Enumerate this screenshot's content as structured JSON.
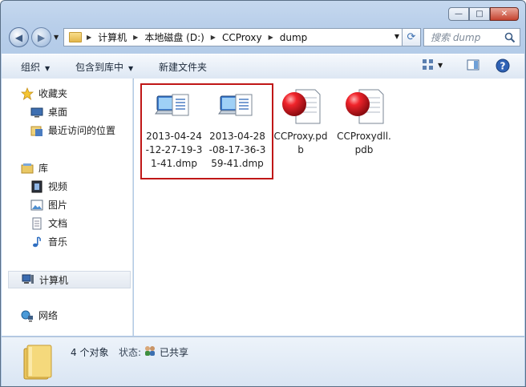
{
  "window": {
    "caption_buttons": {
      "minimize": "—",
      "maximize": "□",
      "close": "✕"
    }
  },
  "nav": {
    "back_icon": "back-arrow-icon",
    "forward_icon": "forward-arrow-icon",
    "breadcrumb": [
      "计算机",
      "本地磁盘 (D:)",
      "CCProxy",
      "dump"
    ],
    "search_placeholder": "搜索 dump"
  },
  "toolbar": {
    "organize": "组织",
    "include_in_library": "包含到库中",
    "new_folder": "新建文件夹"
  },
  "sidebar": {
    "favorites": {
      "label": "收藏夹",
      "items": [
        "桌面",
        "最近访问的位置"
      ]
    },
    "libraries": {
      "label": "库",
      "items": [
        "视频",
        "图片",
        "文档",
        "音乐"
      ]
    },
    "computer": "计算机",
    "network": "网络"
  },
  "files": [
    {
      "name": "2013-04-24-12-27-19-31-41.dmp",
      "type": "dump",
      "selected": true
    },
    {
      "name": "2013-04-28-08-17-36-359-41.dmp",
      "type": "dump",
      "selected": true
    },
    {
      "name": "CCProxy.pdb",
      "type": "pdb",
      "selected": false
    },
    {
      "name": "CCProxydll.pdb",
      "type": "pdb",
      "selected": false
    }
  ],
  "status": {
    "count": "4 个对象",
    "state_label": "状态:",
    "state_value": "已共享"
  },
  "colors": {
    "selection_border": "#c01717",
    "window_frame": "#b9cfea",
    "pdb_icon_red": "#e0141d"
  }
}
